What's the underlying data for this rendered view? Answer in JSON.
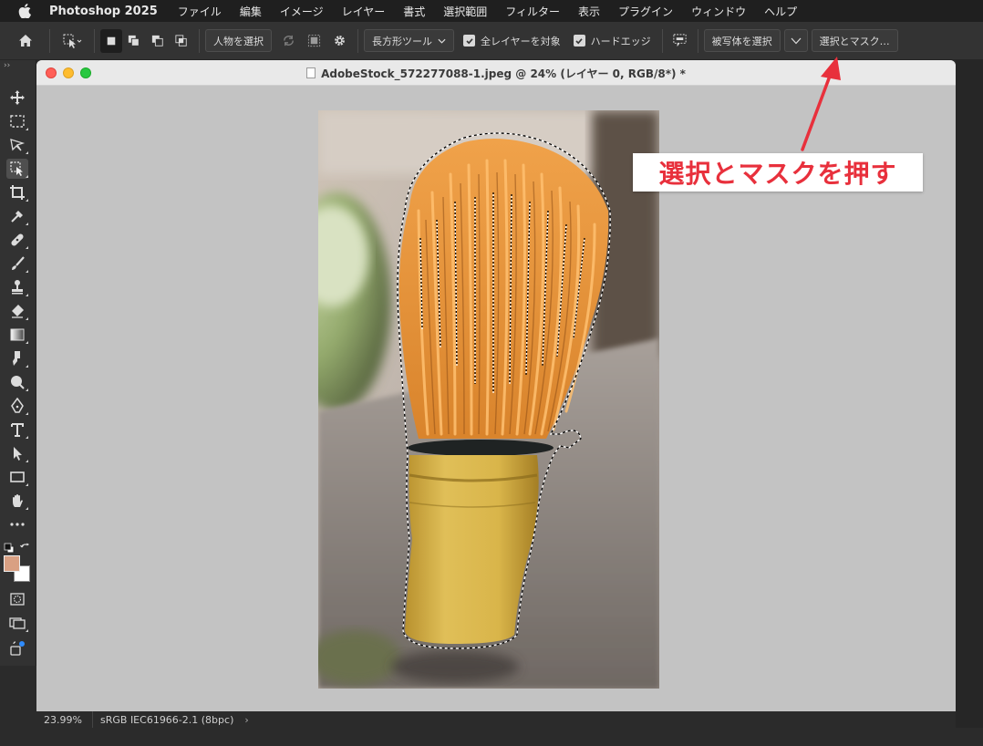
{
  "menubar": {
    "app_name": "Photoshop 2025",
    "items": [
      "ファイル",
      "編集",
      "イメージ",
      "レイヤー",
      "書式",
      "選択範囲",
      "フィルター",
      "表示",
      "プラグイン",
      "ウィンドウ",
      "ヘルプ"
    ]
  },
  "optionsbar": {
    "select_subject_person": "人物を選択",
    "mode_dropdown": "長方形ツール",
    "sample_all_layers": "全レイヤーを対象",
    "hard_edge": "ハードエッジ",
    "select_subject": "被写体を選択",
    "select_and_mask": "選択とマスク…"
  },
  "document": {
    "title": "AdobeStock_572277088-1.jpeg @ 24% (レイヤー 0, RGB/8*) *",
    "zoom": "23.99%",
    "color_profile": "sRGB IEC61966-2.1 (8bpc)"
  },
  "annotation": {
    "text": "選択とマスクを押す",
    "color": "#e8303c"
  },
  "colors": {
    "foreground": "#d9a083",
    "background": "#ffffff"
  },
  "icons": [
    "apple-icon",
    "home-icon",
    "object-selection-icon",
    "new-selection-icon",
    "add-selection-icon",
    "subtract-selection-icon",
    "intersect-selection-icon",
    "refresh-icon",
    "subject-icon",
    "gear-icon",
    "checkbox-icon",
    "chat-icon",
    "chevron-down-icon",
    "move-icon",
    "marquee-icon",
    "lasso-icon",
    "crop-icon",
    "eyedropper-icon",
    "healing-icon",
    "brush-icon",
    "stamp-icon",
    "eraser-icon",
    "gradient-icon",
    "smudge-icon",
    "dodge-icon",
    "pen-icon",
    "type-icon",
    "path-selection-icon",
    "rectangle-icon",
    "hand-icon",
    "more-icon",
    "quick-mask-icon",
    "screen-mode-icon",
    "generative-icon"
  ]
}
